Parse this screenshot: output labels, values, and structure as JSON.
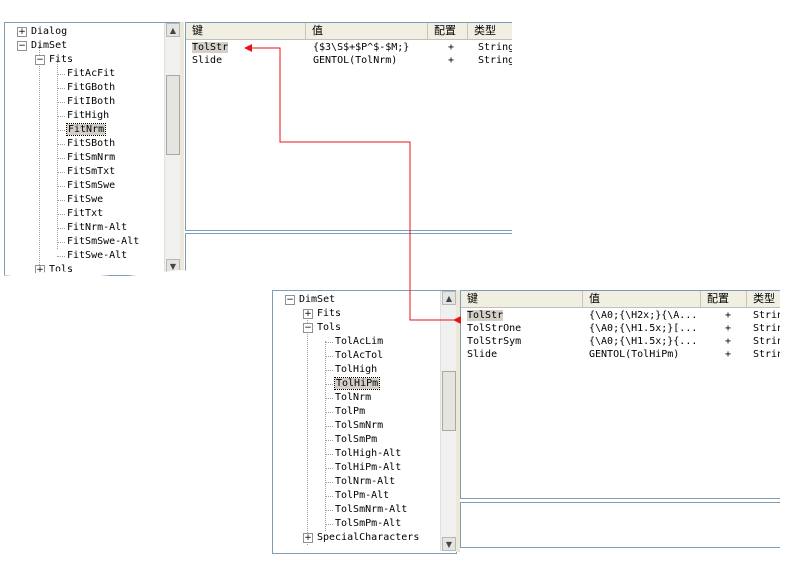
{
  "top": {
    "tree": [
      {
        "label": "Dialog",
        "expander": "+"
      },
      {
        "label": "DimSet",
        "expander": "−"
      },
      {
        "label": "Fits",
        "expander": "−"
      },
      {
        "label": "FitAcFit"
      },
      {
        "label": "FitGBoth"
      },
      {
        "label": "FitIBoth"
      },
      {
        "label": "FitHigh"
      },
      {
        "label": "FitNrm",
        "selected": true
      },
      {
        "label": "FitSBoth"
      },
      {
        "label": "FitSmNrm"
      },
      {
        "label": "FitSmTxt"
      },
      {
        "label": "FitSmSwe"
      },
      {
        "label": "FitSwe"
      },
      {
        "label": "FitTxt"
      },
      {
        "label": "FitNrm-Alt"
      },
      {
        "label": "FitSmSwe-Alt"
      },
      {
        "label": "FitSwe-Alt"
      },
      {
        "label": "Tols",
        "expander": "+"
      }
    ],
    "columns": [
      "键",
      "值",
      "配置",
      "类型"
    ],
    "rows": [
      {
        "key": "TolStr",
        "value": "{$3\\S$+$P^$-$M;}",
        "config": "+",
        "type": "String"
      },
      {
        "key": "Slide",
        "value": "GENTOL(TolNrm)",
        "config": "+",
        "type": "String"
      }
    ]
  },
  "bottom": {
    "tree": [
      {
        "label": "DimSet",
        "expander": "−"
      },
      {
        "label": "Fits",
        "expander": "+"
      },
      {
        "label": "Tols",
        "expander": "−"
      },
      {
        "label": "TolAcLim"
      },
      {
        "label": "TolAcTol"
      },
      {
        "label": "TolHigh"
      },
      {
        "label": "TolHiPm",
        "selected": true
      },
      {
        "label": "TolNrm"
      },
      {
        "label": "TolPm"
      },
      {
        "label": "TolSmNrm"
      },
      {
        "label": "TolSmPm"
      },
      {
        "label": "TolHigh-Alt"
      },
      {
        "label": "TolHiPm-Alt"
      },
      {
        "label": "TolNrm-Alt"
      },
      {
        "label": "TolPm-Alt"
      },
      {
        "label": "TolSmNrm-Alt"
      },
      {
        "label": "TolSmPm-Alt"
      },
      {
        "label": "SpecialCharacters",
        "expander": "+"
      }
    ],
    "columns": [
      "键",
      "值",
      "配置",
      "类型"
    ],
    "rows": [
      {
        "key": "TolStr",
        "value": "{\\A0;{\\H2x;}{\\A...",
        "config": "+",
        "type": "String"
      },
      {
        "key": "TolStrOne",
        "value": "{\\A0;{\\H1.5x;}[...",
        "config": "+",
        "type": "String"
      },
      {
        "key": "TolStrSym",
        "value": "{\\A0;{\\H1.5x;}{...",
        "config": "+",
        "type": "String"
      },
      {
        "key": "Slide",
        "value": "GENTOL(TolHiPm)",
        "config": "+",
        "type": "String"
      }
    ]
  },
  "colors": {
    "arrow": "#e8141c",
    "selection": "#d4d0c8",
    "border": "#7f9db9",
    "header": "#f1efe2"
  },
  "icons": [
    "plus-expander-icon",
    "minus-expander-icon",
    "scroll-up-arrow-icon",
    "scroll-down-arrow-icon"
  ]
}
